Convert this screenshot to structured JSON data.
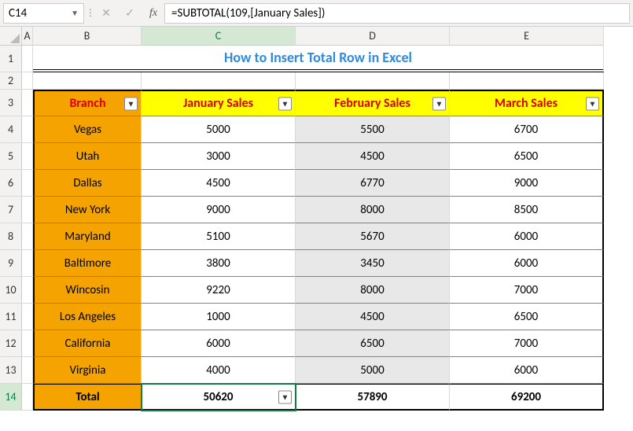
{
  "chart_data": {
    "type": "table",
    "title": "How to Insert Total Row in Excel",
    "columns": [
      "Branch",
      "January Sales",
      "February Sales",
      "March Sales"
    ],
    "rows": [
      [
        "Vegas",
        5000,
        5500,
        6700
      ],
      [
        "Utah",
        3000,
        4500,
        6500
      ],
      [
        "Dallas",
        4500,
        6770,
        9000
      ],
      [
        "New York",
        9000,
        8000,
        8500
      ],
      [
        "Maryland",
        5100,
        5670,
        6000
      ],
      [
        "Baltimore",
        3800,
        3450,
        6000
      ],
      [
        "Wincosin",
        9220,
        8000,
        7000
      ],
      [
        "Los Angeles",
        1000,
        4500,
        6500
      ],
      [
        "California",
        6000,
        6500,
        7000
      ],
      [
        "Virginia",
        4000,
        5000,
        6000
      ]
    ],
    "totals": [
      "Total",
      50620,
      57890,
      69200
    ]
  },
  "name_box": "C14",
  "formula": "=SUBTOTAL(109,[January Sales])",
  "fx_label": "fx",
  "col_letters": {
    "A": "A",
    "B": "B",
    "C": "C",
    "D": "D",
    "E": "E"
  },
  "row_nums": [
    "1",
    "2",
    "3",
    "4",
    "5",
    "6",
    "7",
    "8",
    "9",
    "10",
    "11",
    "12",
    "13",
    "14"
  ],
  "title": "How to Insert Total Row in Excel",
  "headers": {
    "branch": "Branch",
    "jan": "January Sales",
    "feb": "February Sales",
    "mar": "March Sales"
  },
  "rows": {
    "r0": {
      "b": "Vegas",
      "j": "5000",
      "f": "5500",
      "m": "6700"
    },
    "r1": {
      "b": "Utah",
      "j": "3000",
      "f": "4500",
      "m": "6500"
    },
    "r2": {
      "b": "Dallas",
      "j": "4500",
      "f": "6770",
      "m": "9000"
    },
    "r3": {
      "b": "New York",
      "j": "9000",
      "f": "8000",
      "m": "8500"
    },
    "r4": {
      "b": "Maryland",
      "j": "5100",
      "f": "5670",
      "m": "6000"
    },
    "r5": {
      "b": "Baltimore",
      "j": "3800",
      "f": "3450",
      "m": "6000"
    },
    "r6": {
      "b": "Wincosin",
      "j": "9220",
      "f": "8000",
      "m": "7000"
    },
    "r7": {
      "b": "Los Angeles",
      "j": "1000",
      "f": "4500",
      "m": "6500"
    },
    "r8": {
      "b": "California",
      "j": "6000",
      "f": "6500",
      "m": "7000"
    },
    "r9": {
      "b": "Virginia",
      "j": "4000",
      "f": "5000",
      "m": "6000"
    }
  },
  "totals": {
    "b": "Total",
    "j": "50620",
    "f": "57890",
    "m": "69200"
  }
}
